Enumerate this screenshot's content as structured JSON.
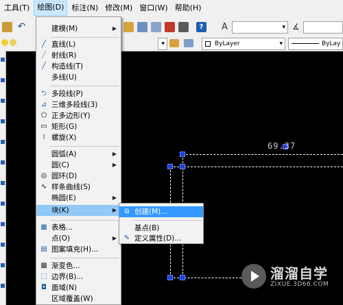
{
  "menubar": {
    "items": [
      {
        "label": "工具(T)"
      },
      {
        "label": "绘图(D)",
        "active": true
      },
      {
        "label": "标注(N)"
      },
      {
        "label": "修改(M)"
      },
      {
        "label": "窗口(W)"
      },
      {
        "label": "帮助(H)"
      }
    ]
  },
  "toolbar": {
    "layer_combo": "ByLayer",
    "linetype_combo": "ByLay"
  },
  "draw_menu": {
    "items": [
      {
        "label": "建模(M)",
        "icon": "none",
        "submenu": true
      },
      {
        "label": "直线(L)",
        "icon": "line-icon"
      },
      {
        "label": "射线(R)",
        "icon": "ray-icon"
      },
      {
        "label": "构造线(T)",
        "icon": "construction-line-icon"
      },
      {
        "label": "多线(U)",
        "icon": "none"
      },
      {
        "label": "多段线(P)",
        "icon": "polyline-icon"
      },
      {
        "label": "三维多段线(3)",
        "icon": "3d-polyline-icon"
      },
      {
        "label": "正多边形(Y)",
        "icon": "polygon-icon"
      },
      {
        "label": "矩形(G)",
        "icon": "rectangle-icon"
      },
      {
        "label": "螺旋(X)",
        "icon": "helix-icon"
      },
      {
        "label": "圆弧(A)",
        "icon": "none",
        "submenu": true
      },
      {
        "label": "圆(C)",
        "icon": "none",
        "submenu": true
      },
      {
        "label": "圆环(D)",
        "icon": "donut-icon"
      },
      {
        "label": "样条曲线(S)",
        "icon": "spline-icon"
      },
      {
        "label": "椭圆(E)",
        "icon": "none",
        "submenu": true
      },
      {
        "label": "块(K)",
        "icon": "none",
        "submenu": true,
        "highlighted": true
      },
      {
        "label": "表格...",
        "icon": "table-icon"
      },
      {
        "label": "点(O)",
        "icon": "none",
        "submenu": true
      },
      {
        "label": "图案填充(H)...",
        "icon": "hatch-icon"
      },
      {
        "label": "渐变色...",
        "icon": "gradient-icon"
      },
      {
        "label": "边界(B)...",
        "icon": "boundary-icon"
      },
      {
        "label": "面域(N)",
        "icon": "region-icon"
      },
      {
        "label": "区域覆盖(W)",
        "icon": "none"
      }
    ]
  },
  "block_submenu": {
    "items": [
      {
        "label": "创建(M)...",
        "icon": "create-block-icon",
        "highlighted": true
      },
      {
        "label": "基点(B)",
        "icon": "none"
      },
      {
        "label": "定义属性(D)...",
        "icon": "define-attribute-icon"
      }
    ]
  },
  "drawing": {
    "dimension_text": "69.37"
  },
  "watermark": {
    "title": "溜溜自学",
    "url": "ZIXUE.3D66.COM"
  }
}
